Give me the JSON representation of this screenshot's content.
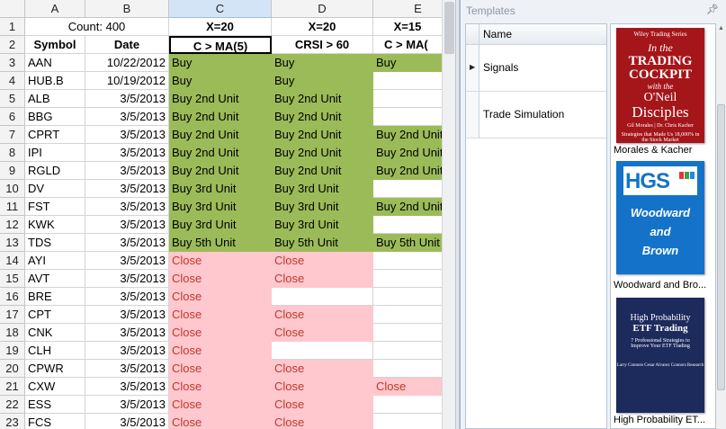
{
  "sheet": {
    "columns": [
      "A",
      "B",
      "C",
      "D",
      "E"
    ],
    "row1": {
      "b": "Count: 400",
      "c": "X=20",
      "d": "X=20",
      "e": "X=15"
    },
    "row2": {
      "a": "Symbol",
      "b": "Date",
      "c": "C > MA(5)",
      "d": "CRSI > 60",
      "e": "C > MA("
    },
    "rows": [
      {
        "n": "3",
        "sym": "AAN",
        "date": "10/22/2012",
        "c": "Buy",
        "d": "Buy",
        "e": "Buy"
      },
      {
        "n": "4",
        "sym": "HUB.B",
        "date": "10/19/2012",
        "c": "Buy",
        "d": "Buy",
        "e": ""
      },
      {
        "n": "5",
        "sym": "ALB",
        "date": "3/5/2013",
        "c": "Buy 2nd Unit",
        "d": "Buy 2nd Unit",
        "e": ""
      },
      {
        "n": "6",
        "sym": "BBG",
        "date": "3/5/2013",
        "c": "Buy 2nd Unit",
        "d": "Buy 2nd Unit",
        "e": ""
      },
      {
        "n": "7",
        "sym": "CPRT",
        "date": "3/5/2013",
        "c": "Buy 2nd Unit",
        "d": "Buy 2nd Unit",
        "e": "Buy 2nd Unit"
      },
      {
        "n": "8",
        "sym": "IPI",
        "date": "3/5/2013",
        "c": "Buy 2nd Unit",
        "d": "Buy 2nd Unit",
        "e": "Buy 2nd Unit"
      },
      {
        "n": "9",
        "sym": "RGLD",
        "date": "3/5/2013",
        "c": "Buy 2nd Unit",
        "d": "Buy 2nd Unit",
        "e": "Buy 2nd Unit"
      },
      {
        "n": "10",
        "sym": "DV",
        "date": "3/5/2013",
        "c": "Buy 3rd Unit",
        "d": "Buy 3rd Unit",
        "e": ""
      },
      {
        "n": "11",
        "sym": "FST",
        "date": "3/5/2013",
        "c": "Buy 3rd Unit",
        "d": "Buy 3rd Unit",
        "e": "Buy 2nd Unit"
      },
      {
        "n": "12",
        "sym": "KWK",
        "date": "3/5/2013",
        "c": "Buy 3rd Unit",
        "d": "Buy 3rd Unit",
        "e": ""
      },
      {
        "n": "13",
        "sym": "TDS",
        "date": "3/5/2013",
        "c": "Buy 5th Unit",
        "d": "Buy 5th Unit",
        "e": "Buy 5th Unit"
      },
      {
        "n": "14",
        "sym": "AYI",
        "date": "3/5/2013",
        "c": "Close",
        "d": "Close",
        "e": ""
      },
      {
        "n": "15",
        "sym": "AVT",
        "date": "3/5/2013",
        "c": "Close",
        "d": "Close",
        "e": ""
      },
      {
        "n": "16",
        "sym": "BRE",
        "date": "3/5/2013",
        "c": "Close",
        "d": "",
        "e": ""
      },
      {
        "n": "17",
        "sym": "CPT",
        "date": "3/5/2013",
        "c": "Close",
        "d": "Close",
        "e": ""
      },
      {
        "n": "18",
        "sym": "CNK",
        "date": "3/5/2013",
        "c": "Close",
        "d": "Close",
        "e": ""
      },
      {
        "n": "19",
        "sym": "CLH",
        "date": "3/5/2013",
        "c": "Close",
        "d": "",
        "e": ""
      },
      {
        "n": "20",
        "sym": "CPWR",
        "date": "3/5/2013",
        "c": "Close",
        "d": "Close",
        "e": ""
      },
      {
        "n": "21",
        "sym": "CXW",
        "date": "3/5/2013",
        "c": "Close",
        "d": "Close",
        "e": "Close"
      },
      {
        "n": "22",
        "sym": "ESS",
        "date": "3/5/2013",
        "c": "Close",
        "d": "Close",
        "e": ""
      },
      {
        "n": "23",
        "sym": "FCS",
        "date": "3/5/2013",
        "c": "Close",
        "d": "Close",
        "e": ""
      }
    ],
    "colors": {
      "buy": "#9bbb59",
      "close_fill": "#ffc7ce",
      "close_text": "#c0392b"
    }
  },
  "templates": {
    "title": "Templates",
    "pin_icon": "pin-icon",
    "grid_header": "Name",
    "items": [
      {
        "label": "Signals",
        "selected": true
      },
      {
        "label": "Trade Simulation",
        "selected": false
      }
    ],
    "books": [
      {
        "caption": "Morales & Kacher",
        "cover": {
          "series": "Wiley Trading Series",
          "in_the": "In the",
          "trading": "TRADING",
          "cockpit": "COCKPIT",
          "with_the": "with the",
          "oneil": "O'Neil",
          "disciples": "Disciples",
          "subtitle": "Strategies that Made Us 18,000% in the Stock Market",
          "authors": "Gil Morales | Dr. Chris Kacher"
        }
      },
      {
        "caption": "Woodward and Bro...",
        "cover": {
          "logo": "HGS",
          "line1": "Woodward",
          "line2": "and",
          "line3": "Brown"
        }
      },
      {
        "caption": "High Probability ET...",
        "cover": {
          "title1": "High Probability",
          "title2": "ETF Trading",
          "subtitle": "7 Professional Strategies to Improve Your ETF Trading",
          "authors": "Larry Connors  Cesar Alvarez  Connors Research"
        }
      }
    ]
  }
}
